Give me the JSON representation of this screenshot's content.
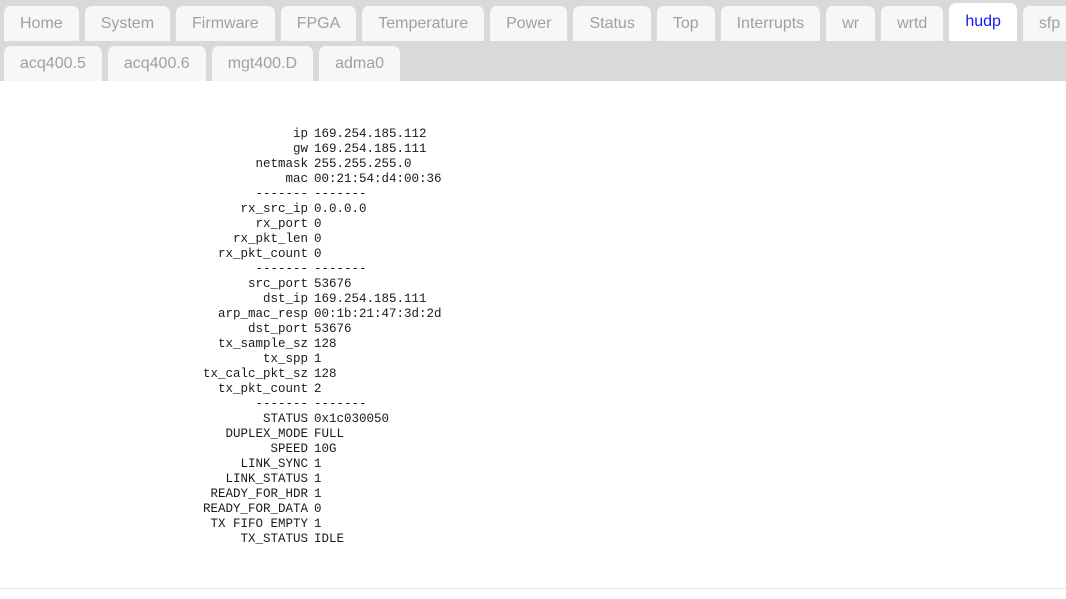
{
  "tabs": {
    "row1": [
      {
        "label": "Home",
        "active": false
      },
      {
        "label": "System",
        "active": false
      },
      {
        "label": "Firmware",
        "active": false
      },
      {
        "label": "FPGA",
        "active": false
      },
      {
        "label": "Temperature",
        "active": false
      },
      {
        "label": "Power",
        "active": false
      },
      {
        "label": "Status",
        "active": false
      },
      {
        "label": "Top",
        "active": false
      },
      {
        "label": "Interrupts",
        "active": false
      },
      {
        "label": "wr",
        "active": false
      },
      {
        "label": "wrtd",
        "active": false
      },
      {
        "label": "hudp",
        "active": true
      },
      {
        "label": "sfp",
        "active": false
      }
    ],
    "row2": [
      {
        "label": "acq400.5",
        "active": false
      },
      {
        "label": "acq400.6",
        "active": false
      },
      {
        "label": "mgt400.D",
        "active": false
      },
      {
        "label": "adma0",
        "active": false
      }
    ],
    "active_tab": "hudp",
    "active_color": "#1414ff",
    "inactive_color": "#a0a0a0",
    "bar_background": "#d9d9d9"
  },
  "report": {
    "rows": [
      {
        "key": "ip",
        "value": "169.254.185.112"
      },
      {
        "key": "gw",
        "value": "169.254.185.111"
      },
      {
        "key": "netmask",
        "value": "255.255.255.0"
      },
      {
        "key": "mac",
        "value": "00:21:54:d4:00:36"
      },
      {
        "key": "-------",
        "value": "-------"
      },
      {
        "key": "rx_src_ip",
        "value": "0.0.0.0"
      },
      {
        "key": "rx_port",
        "value": "0"
      },
      {
        "key": "rx_pkt_len",
        "value": "0"
      },
      {
        "key": "rx_pkt_count",
        "value": "0"
      },
      {
        "key": "-------",
        "value": "-------"
      },
      {
        "key": "src_port",
        "value": "53676"
      },
      {
        "key": "dst_ip",
        "value": "169.254.185.111"
      },
      {
        "key": "arp_mac_resp",
        "value": "00:1b:21:47:3d:2d"
      },
      {
        "key": "dst_port",
        "value": "53676"
      },
      {
        "key": "tx_sample_sz",
        "value": "128"
      },
      {
        "key": "tx_spp",
        "value": "1"
      },
      {
        "key": "tx_calc_pkt_sz",
        "value": "128"
      },
      {
        "key": "tx_pkt_count",
        "value": "2"
      },
      {
        "key": "-------",
        "value": "-------"
      },
      {
        "key": "STATUS",
        "value": "0x1c030050"
      },
      {
        "key": "DUPLEX_MODE",
        "value": "FULL"
      },
      {
        "key": "SPEED",
        "value": "10G"
      },
      {
        "key": "LINK_SYNC",
        "value": "1"
      },
      {
        "key": "LINK_STATUS",
        "value": "1"
      },
      {
        "key": "READY_FOR_HDR",
        "value": "1"
      },
      {
        "key": "READY_FOR_DATA",
        "value": "0"
      },
      {
        "key": "TX FIFO EMPTY",
        "value": "1"
      },
      {
        "key": "TX_STATUS",
        "value": "IDLE"
      }
    ]
  }
}
